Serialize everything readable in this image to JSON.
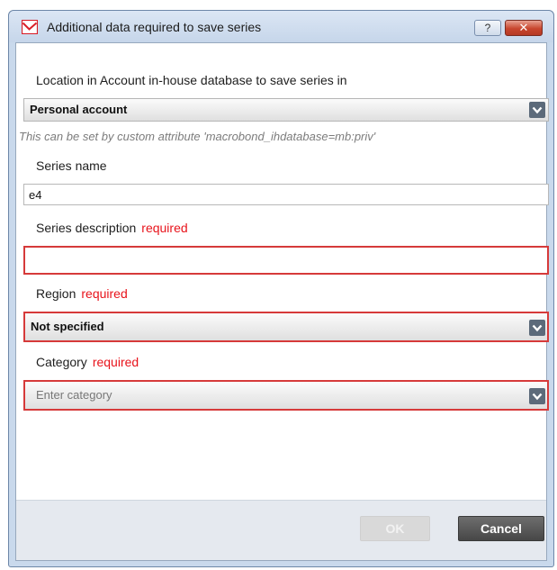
{
  "window": {
    "title": "Additional data required to save series",
    "help_label": "?",
    "close_label": "✕"
  },
  "location": {
    "label": "Location in Account in-house database to save series in",
    "selected": "Personal account",
    "hint": "This can be set by custom attribute 'macrobond_ihdatabase=mb:priv'"
  },
  "series_name": {
    "label": "Series name",
    "value": "e4"
  },
  "series_description": {
    "label": "Series description",
    "required_text": "required",
    "value": ""
  },
  "region": {
    "label": "Region",
    "required_text": "required",
    "selected": "Not specified"
  },
  "category": {
    "label": "Category",
    "required_text": "required",
    "placeholder": "Enter category"
  },
  "footer": {
    "ok_label": "OK",
    "cancel_label": "Cancel"
  },
  "colors": {
    "required": "#e8131b",
    "error_border": "#d63a3a",
    "cancel_button": "#474747"
  },
  "icons": [
    "chart-line-icon",
    "help-icon",
    "close-icon",
    "chevron-down-icon"
  ]
}
